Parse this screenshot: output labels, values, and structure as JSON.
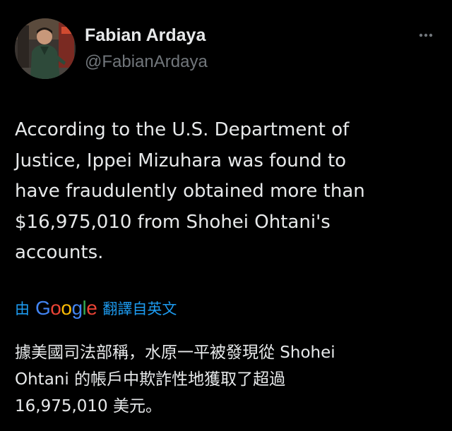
{
  "colors": {
    "background": "#000000",
    "text_primary": "#e7e9ea",
    "text_secondary": "#71767b",
    "link_blue": "#1d9bf0"
  },
  "author": {
    "display_name": "Fabian Ardaya",
    "handle": "@FabianArdaya",
    "avatar_icon": "profile-photo"
  },
  "more_menu": {
    "icon": "more-horizontal-icon"
  },
  "tweet": {
    "text": "According to the U.S. Department of\nJustice, Ippei Mizuhara was found to\nhave fraudulently obtained more than\n$16,975,010 from Shohei Ohtani's\naccounts."
  },
  "translation": {
    "prefix": "由",
    "provider_logo_text": "Google",
    "link_label": "翻譯自英文",
    "translated_text": "據美國司法部稱，水原一平被發現從 Shohei\nOhtani 的帳戶中欺詐性地獲取了超過\n16,975,010 美元。"
  }
}
